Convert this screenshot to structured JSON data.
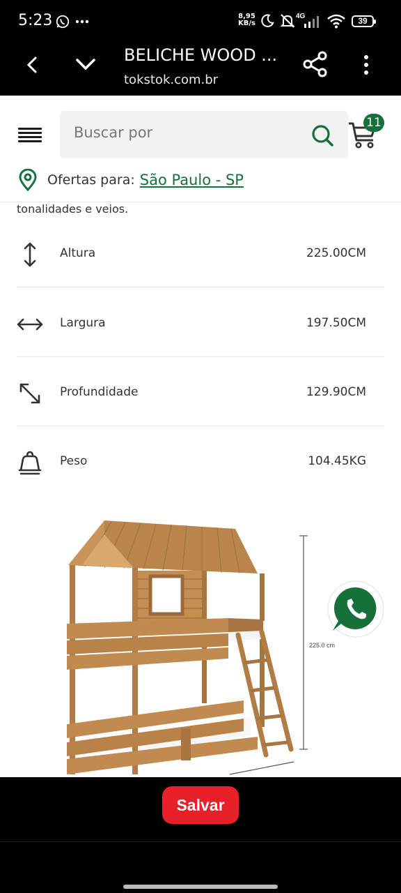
{
  "status_bar": {
    "time": "5:23",
    "net_speed_value": "8,95",
    "net_speed_unit": "KB/s",
    "network": "4G",
    "battery": "39"
  },
  "browser": {
    "title": "BELICHE WOOD ...",
    "domain": "tokstok.com.br"
  },
  "header": {
    "search_placeholder": "Buscar por",
    "cart_count": "11",
    "offers_label": "Ofertas para:",
    "location": "São Paulo - SP"
  },
  "product": {
    "description_tail": "tonalidades e veios.",
    "specs": [
      {
        "icon": "height-arrows-icon",
        "label": "Altura",
        "value": "225.00CM"
      },
      {
        "icon": "width-arrows-icon",
        "label": "Largura",
        "value": "197.50CM"
      },
      {
        "icon": "depth-arrows-icon",
        "label": "Profundidade",
        "value": "129.90CM"
      },
      {
        "icon": "weight-icon",
        "label": "Peso",
        "value": "104.45KG"
      }
    ],
    "image_dimension_label": "225.0 cm"
  },
  "actions": {
    "save_label": "Salvar"
  },
  "colors": {
    "brand_green": "#16703a",
    "save_red": "#e8202a",
    "whatsapp_green": "#25d366"
  }
}
